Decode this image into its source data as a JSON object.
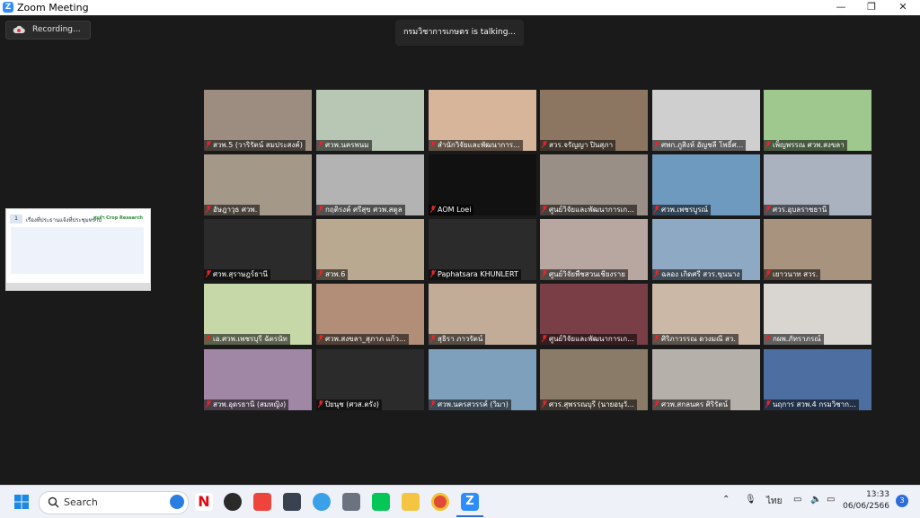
{
  "window": {
    "title": "Zoom Meeting",
    "logo_letter": "Z",
    "minimize": "—",
    "maximize": "❐",
    "close": "✕"
  },
  "recording": {
    "label": "Recording..."
  },
  "talking": {
    "text": "กรมวิชาการเกษตร is talking..."
  },
  "shared_thumbnail": {
    "slide_number": "1",
    "caption": "เรื่องที่ประธานแจ้งที่ประชุมทราบ",
    "brand": "ศูนย์ฯ Crop Research"
  },
  "participants": [
    {
      "name": "สวพ.5 (วาริรัตน์ สมประสงค์)",
      "bg": "#9c8d80"
    },
    {
      "name": "ศวพ.นครพนม",
      "bg": "#b8c6b4"
    },
    {
      "name": "สำนักวิจัยและพัฒนาการ...",
      "bg": "#d7b59a"
    },
    {
      "name": "สวร.จรัญญา ปินสุภา",
      "bg": "#8c7662"
    },
    {
      "name": "ศพก.ภูสิงห์ อัญชลี โพธิ์ศ...",
      "bg": "#cfcfcf"
    },
    {
      "name": "เพ็ญพรรณ ศวพ.สงขลา",
      "bg": "#9ec88e"
    },
    {
      "name": "อัษฎาวุธ ศวพ.",
      "bg": "#a49888"
    },
    {
      "name": "กฤติรงค์ ศรีสุข ศวพ.สตูล",
      "bg": "#b3b3b3"
    },
    {
      "name": "AOM Loei",
      "bg": "#111111"
    },
    {
      "name": "ศูนย์วิจัยและพัฒนาการเก...",
      "bg": "#9a8f86"
    },
    {
      "name": "ศวพ.เพชรบูรณ์",
      "bg": "#6f9ac0"
    },
    {
      "name": "ศวร.อุบลราชธานี",
      "bg": "#aab2c0"
    },
    {
      "name": "ศวพ.สุราษฎร์ธานี",
      "bg": "#2b2b2b"
    },
    {
      "name": "สวพ.6",
      "bg": "#b9a990"
    },
    {
      "name": "Paphatsara KHUNLERT",
      "bg": "#2b2b2b"
    },
    {
      "name": "ศูนย์วิจัยพืชสวนเชียงราย",
      "bg": "#b7a7a0"
    },
    {
      "name": "ฉลอง เกิดศรี สวร.ขุนนาง",
      "bg": "#8ea9c4"
    },
    {
      "name": "เยาวนาท สวร.",
      "bg": "#a8937e"
    },
    {
      "name": "เอ.ศวพ.เพชรบุรี ฉัตรนัท",
      "bg": "#c7d8a8"
    },
    {
      "name": "ศวพ.สงขลา_สุภาภ แก้ว...",
      "bg": "#b28e78"
    },
    {
      "name": "สุธิรา ภาวรัตน์",
      "bg": "#c2ab97"
    },
    {
      "name": "ศูนย์วิจัยและพัฒนาการเก...",
      "bg": "#7a3e46"
    },
    {
      "name": "ศิริภาวรรณ ดวงมณี สว.",
      "bg": "#cbb8a6"
    },
    {
      "name": "กผพ.ภัทราภรณ์",
      "bg": "#d9d6d2"
    },
    {
      "name": "สวพ.อุดรธานี (สมหญิง)",
      "bg": "#9f87a5"
    },
    {
      "name": "ปิยนุช (ศวส.ตรัง)",
      "bg": "#2b2b2b"
    },
    {
      "name": "ศวพ.นครสวรรค์ (วิมา)",
      "bg": "#7fa0bd"
    },
    {
      "name": "ศวร.สุพรรณบุรี (นายอนุวั...",
      "bg": "#8a7a68"
    },
    {
      "name": "ศวพ.สกลนคร ศิริรัตน์",
      "bg": "#b6b0aa"
    },
    {
      "name": "นฤการ สวพ.4 กรมวิชาก...",
      "bg": "#4d6ea0"
    }
  ],
  "taskbar": {
    "search_placeholder": "Search",
    "apps": [
      "windows-icon",
      "netflix-icon",
      "gauge-icon",
      "anydesk-icon",
      "terminal-icon",
      "photos-icon",
      "calculator-icon",
      "line-icon",
      "explorer-icon",
      "chrome-icon",
      "zoom-icon"
    ],
    "lang": "ไทย",
    "time": "13:33",
    "date": "06/06/2566",
    "notifications": "3"
  }
}
